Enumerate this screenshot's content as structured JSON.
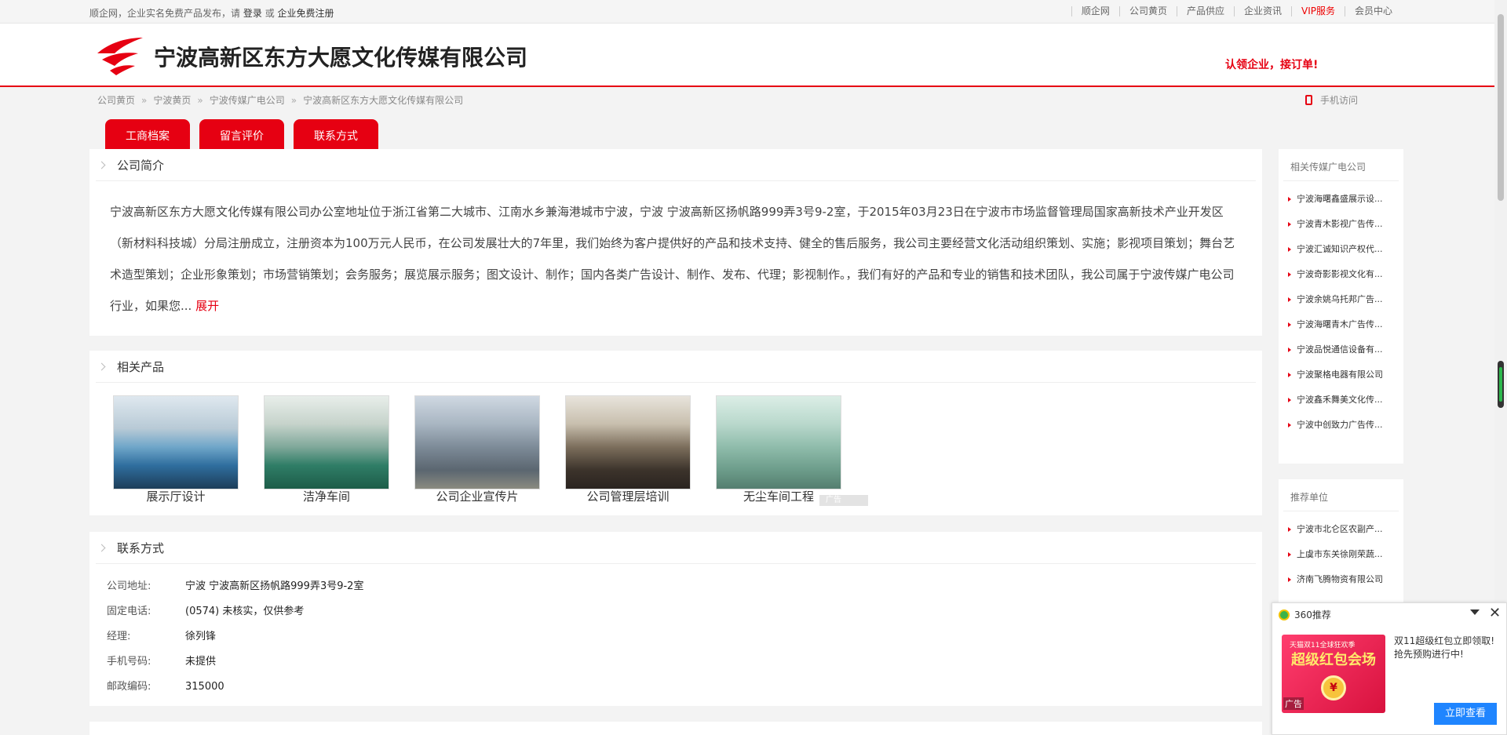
{
  "topbar": {
    "intro_prefix": "顺企网，企业实名免费产品发布，请",
    "login": "登录",
    "or": "或",
    "register": "企业免费注册",
    "links": [
      "顺企网",
      "公司黄页",
      "产品供应",
      "企业资讯",
      "VIP服务",
      "会员中心"
    ]
  },
  "header": {
    "company_name": "宁波高新区东方大愿文化传媒有限公司",
    "claim": "认领企业，接订单!"
  },
  "breadcrumb": {
    "items": [
      "公司黄页",
      "宁波黄页",
      "宁波传媒广电公司",
      "宁波高新区东方大愿文化传媒有限公司"
    ],
    "separator": "»",
    "mobile": "手机访问"
  },
  "tabs": [
    "工商档案",
    "留言评价",
    "联系方式"
  ],
  "intro": {
    "title": "公司简介",
    "text": "宁波高新区东方大愿文化传媒有限公司办公室地址位于浙江省第二大城市、江南水乡兼海港城市宁波，宁波 宁波高新区扬帆路999弄3号9-2室，于2015年03月23日在宁波市市场监督管理局国家高新技术产业开发区（新材料科技城）分局注册成立，注册资本为100万元人民币，在公司发展壮大的7年里，我们始终为客户提供好的产品和技术支持、健全的售后服务，我公司主要经营文化活动组织策划、实施；影视项目策划；舞台艺术造型策划；企业形象策划；市场营销策划；会务服务；展览展示服务；图文设计、制作；国内各类广告设计、制作、发布、代理；影视制作。，我们有好的产品和专业的销售和技术团队，我公司属于宁波传媒广电公司行业，如果您...",
    "expand": "展开"
  },
  "products": {
    "title": "相关产品",
    "items": [
      "展示厅设计",
      "洁净车间",
      "公司企业宣传片",
      "公司管理层培训",
      "无尘车间工程"
    ],
    "ad_tag": "广告"
  },
  "contact": {
    "title": "联系方式",
    "rows": [
      {
        "label": "公司地址:",
        "value": "宁波 宁波高新区扬帆路999弄3号9-2室"
      },
      {
        "label": "固定电话:",
        "value": "(0574) 未核实，仅供参考"
      },
      {
        "label": "经理:",
        "value": "徐列锋"
      },
      {
        "label": "手机号码:",
        "value": "未提供"
      },
      {
        "label": "邮政编码:",
        "value": "315000"
      }
    ]
  },
  "sidebar": {
    "related_title": "相关传媒广电公司",
    "related": [
      "宁波海曙鑫盛展示设...",
      "宁波青木影视广告传...",
      "宁波汇诚知识产权代...",
      "宁波奇影影视文化有...",
      "宁波余姚乌托邦广告...",
      "宁波海曙青木广告传...",
      "宁波品悦通信设备有...",
      "宁波聚格电器有限公司",
      "宁波鑫禾舞美文化传...",
      "宁波中创致力广告传..."
    ],
    "recommend_title": "推荐单位",
    "recommend": [
      "宁波市北仑区农副产...",
      "上虞市东关徐刚荣蔬...",
      "济南飞腾物资有限公司"
    ]
  },
  "popup": {
    "header": "360推荐",
    "banner_small": "天猫双11全球狂欢季",
    "banner_big": "超级红包会场",
    "ad_label": "广告",
    "text": "双11超级红包立即领取!抢先预购进行中!",
    "button": "立即查看"
  },
  "colors": {
    "brand_red": "#e60012",
    "popup_button": "#1f85ff"
  }
}
